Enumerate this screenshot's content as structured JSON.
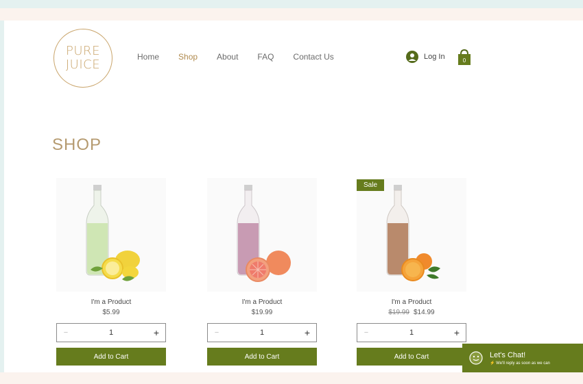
{
  "brand": {
    "line1": "PURE",
    "line2": "JUICE"
  },
  "nav": {
    "items": [
      {
        "label": "Home"
      },
      {
        "label": "Shop"
      },
      {
        "label": "About"
      },
      {
        "label": "FAQ"
      },
      {
        "label": "Contact Us"
      }
    ],
    "active": "Shop"
  },
  "account": {
    "login_label": "Log In",
    "cart_count": "0"
  },
  "shop": {
    "title": "SHOP"
  },
  "products": [
    {
      "name": "I'm a Product",
      "price": "$5.99",
      "qty": "1",
      "add_label": "Add to Cart",
      "liquid_color": "#cfe6b4",
      "fruit": "lemon"
    },
    {
      "name": "I'm a Product",
      "price": "$19.99",
      "qty": "1",
      "add_label": "Add to Cart",
      "liquid_color": "#c89bb3",
      "fruit": "grapefruit"
    },
    {
      "name": "I'm a Product",
      "old_price": "$19.99",
      "price": "$14.99",
      "qty": "1",
      "add_label": "Add to Cart",
      "badge": "Sale",
      "liquid_color": "#b98a6c",
      "fruit": "orange"
    }
  ],
  "chat": {
    "title": "Let's Chat!",
    "subtitle": "We'll reply as soon as we can"
  },
  "colors": {
    "accent": "#667c1d",
    "brand_gold": "#c9a46a"
  }
}
